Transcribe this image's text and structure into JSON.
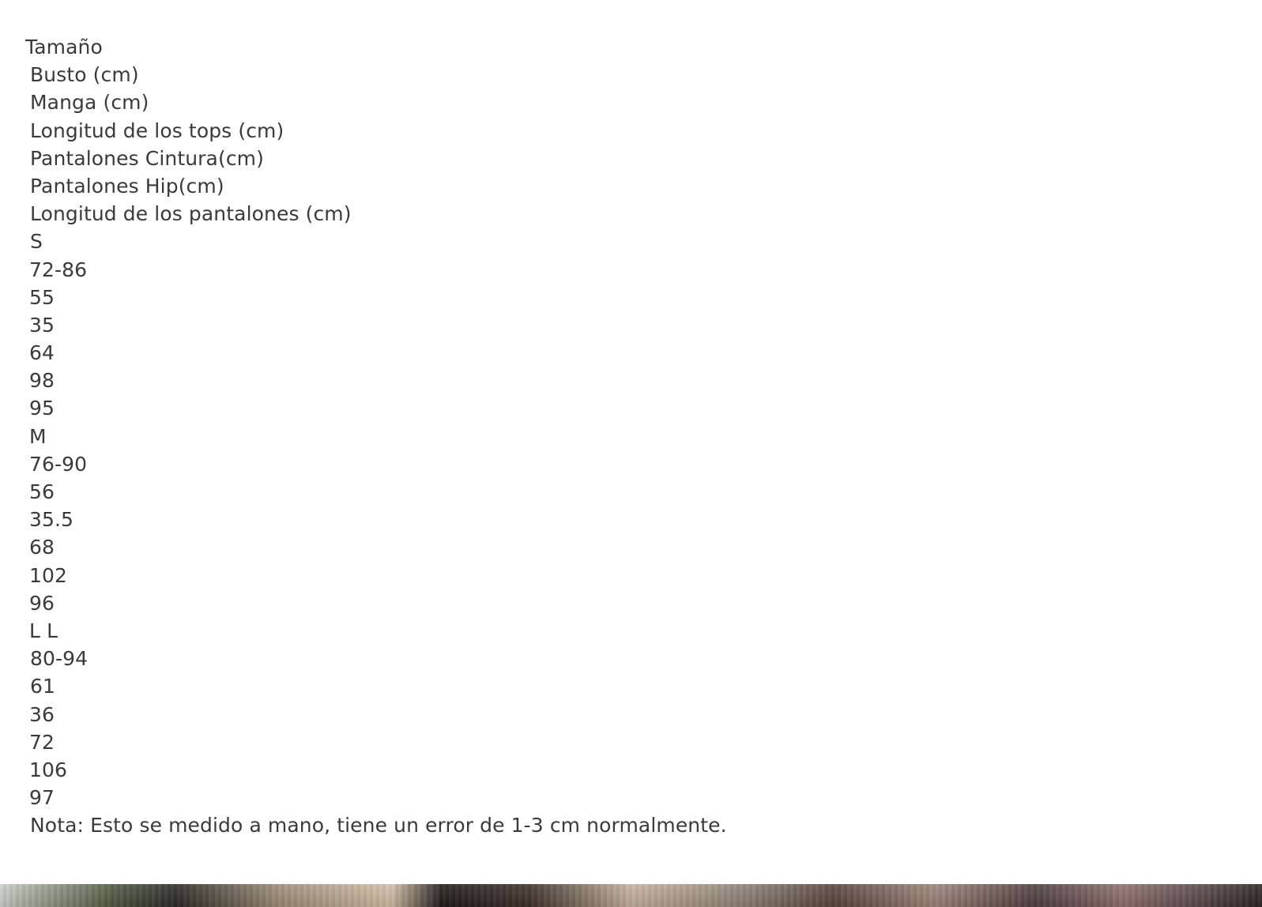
{
  "size_chart": {
    "header_label": "Tamaño",
    "columns": [
      "Busto (cm)",
      "Manga (cm)",
      "Longitud de los tops (cm)",
      "Pantalones Cintura(cm)",
      "Pantalones Hip(cm)",
      "Longitud de los pantalones (cm)"
    ],
    "rows": [
      {
        "size": "S",
        "values": [
          "72-86",
          "55",
          "35",
          "64",
          "98",
          "95"
        ]
      },
      {
        "size": "M",
        "values": [
          "76-90",
          "56",
          "35.5",
          "68",
          "102",
          "96"
        ]
      },
      {
        "size": "L L",
        "values": [
          "80-94",
          "61",
          "36",
          "72",
          "106",
          "97"
        ]
      }
    ],
    "note": "Nota: Esto se medido a mano, tiene un error de 1-3 cm normalmente."
  }
}
